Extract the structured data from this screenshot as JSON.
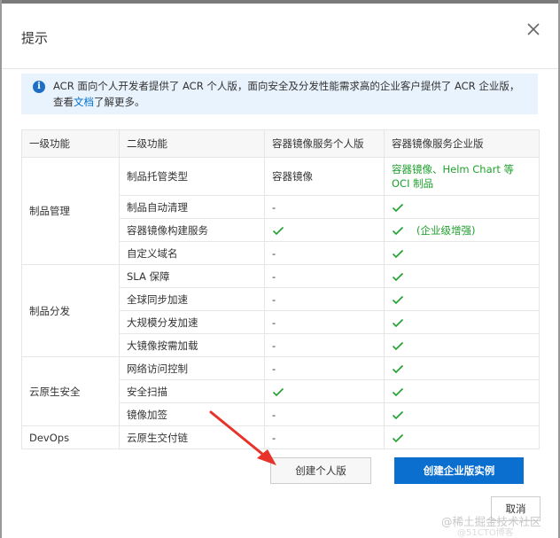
{
  "dialog": {
    "title": "提示",
    "close_glyph": "×"
  },
  "notice": {
    "icon": "info-icon",
    "text_before": "ACR 面向个人开发者提供了 ACR 个人版，面向安全及分发性能需求高的企业客户提供了 ACR 企业版，查看",
    "link_text": "文档",
    "text_after": "了解更多。"
  },
  "table": {
    "headers": [
      "一级功能",
      "二级功能",
      "容器镜像服务个人版",
      "容器镜像服务企业版"
    ],
    "groups": [
      {
        "name": "制品管理",
        "rows": [
          {
            "feature": "制品托管类型",
            "personal": "容器镜像",
            "enterprise": "容器镜像、Helm Chart 等 OCI 制品"
          },
          {
            "feature": "制品自动清理",
            "personal": "-",
            "enterprise": "check"
          },
          {
            "feature": "容器镜像构建服务",
            "personal": "check",
            "enterprise": "check",
            "enterprise_note": "(企业级增强)"
          },
          {
            "feature": "自定义域名",
            "personal": "-",
            "enterprise": "check"
          }
        ]
      },
      {
        "name": "制品分发",
        "rows": [
          {
            "feature": "SLA 保障",
            "personal": "-",
            "enterprise": "check"
          },
          {
            "feature": "全球同步加速",
            "personal": "-",
            "enterprise": "check"
          },
          {
            "feature": "大规模分发加速",
            "personal": "-",
            "enterprise": "check"
          },
          {
            "feature": "大镜像按需加载",
            "personal": "-",
            "enterprise": "check"
          }
        ]
      },
      {
        "name": "云原生安全",
        "rows": [
          {
            "feature": "网络访问控制",
            "personal": "-",
            "enterprise": "check"
          },
          {
            "feature": "安全扫描",
            "personal": "check",
            "enterprise": "check"
          },
          {
            "feature": "镜像加签",
            "personal": "-",
            "enterprise": "check"
          }
        ]
      },
      {
        "name": "DevOps",
        "rows": [
          {
            "feature": "云原生交付链",
            "personal": "-",
            "enterprise": "check"
          }
        ]
      }
    ]
  },
  "buttons": {
    "create_personal": "创建个人版",
    "create_enterprise": "创建企业版实例",
    "cancel": "取消"
  },
  "watermark": {
    "line1": "@稀土掘金技术社区",
    "line2": "@51CTO博客"
  },
  "colors": {
    "primary": "#0b6fd0",
    "success": "#1fa12e",
    "notice_bg": "#e9f3fd",
    "arrow": "#e8332a"
  }
}
